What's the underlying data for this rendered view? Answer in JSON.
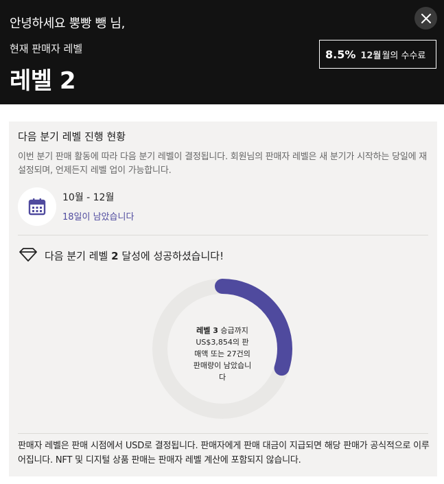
{
  "header": {
    "greeting": "안녕하세요 뿡빵 뺑 님,",
    "level_caption": "현재 판매자 레벨",
    "level_title": "레벨 2",
    "fee": {
      "rate": "8.5%",
      "month": "12월",
      "label": "월의 수수료"
    },
    "close_icon": "close-icon"
  },
  "progress": {
    "title": "다음 분기 레벨 진행 현황",
    "description": "이번 분기 판매 활동에 따라 다음 분기 레벨이 결정됩니다. 회원님의 판매자 레벨은 새 분기가 시작하는 당일에 재설정되며, 언제든지 레벨 업이 가능합니다.",
    "period": "10월 - 12월",
    "days_left_num": "18",
    "days_left_text": "일이 남았습니다",
    "calendar_icon": "calendar-icon",
    "achievement_prefix": "다음 분기 레벨 ",
    "achievement_level": "2",
    "achievement_suffix": " 달성에 성공하셨습니다!",
    "diamond_icon": "diamond-icon",
    "donut": {
      "progress_fraction": 0.3,
      "track_color": "#e9e8e6",
      "fill_color": "#4f4a9e",
      "level_strong": "레벨 3",
      "text_after_level": " 승급까지 US$3,854의 판매액 또는 27건의 판매량이 남았습니다"
    },
    "footnote": "판매자 레벨은 판매 시점에서 USD로 결정됩니다. 판매자에게 판매 대금이 지급되면 해당 판매가 공식적으로 이루어집니다. NFT 및 디지털 상품 판매는 판매자 레벨 계산에 포함되지 않습니다."
  }
}
